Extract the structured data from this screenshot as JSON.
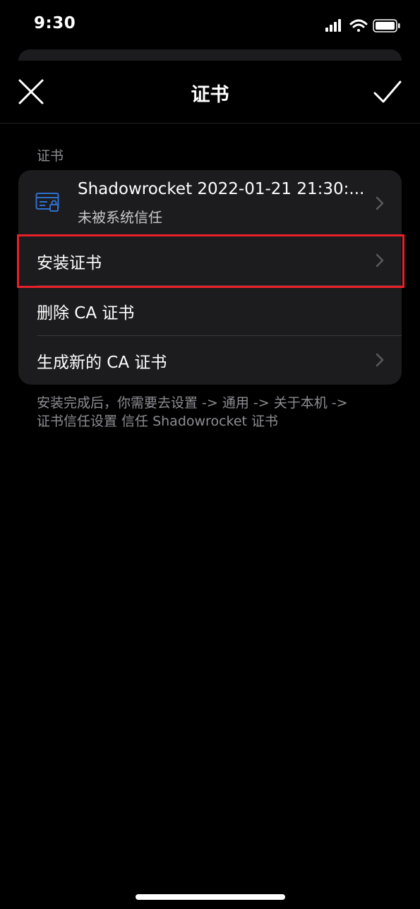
{
  "status_bar": {
    "time": "9:30",
    "icons": [
      "cellular-signal-icon",
      "wifi-icon",
      "battery-icon"
    ]
  },
  "nav": {
    "title": "证书",
    "close_icon": "close-icon",
    "done_icon": "checkmark-icon"
  },
  "section": {
    "header": "证书"
  },
  "certificate": {
    "title": "Shadowrocket 2022-01-21 21:30:...",
    "status": "未被系统信任",
    "icon": "certificate-icon"
  },
  "actions": {
    "install": "安装证书",
    "delete": "删除 CA 证书",
    "generate": "生成新的 CA 证书"
  },
  "footer": {
    "line1": "安装完成后，你需要去设置 -> 通用 -> 关于本机 ->",
    "line2": "证书信任设置 信任 Shadowrocket 证书"
  },
  "colors": {
    "background": "#000000",
    "card": "#1c1c1e",
    "secondary_text": "#8e8e93",
    "accent_icon": "#2f6fcf",
    "highlight": "#e8202a"
  }
}
